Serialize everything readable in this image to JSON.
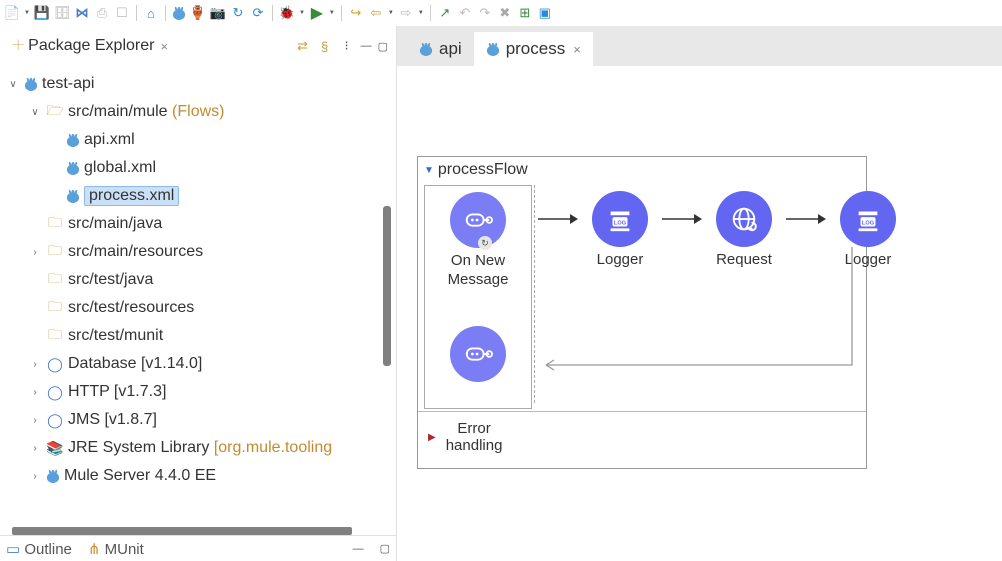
{
  "toolbar": {
    "icons": [
      "new",
      "save",
      "save-all",
      "vs",
      "disk",
      "box",
      "nav",
      "bunny",
      "jar",
      "camera",
      "build",
      "cycle",
      "bug",
      "run",
      "step-out",
      "step-back",
      "step-fwd",
      "stop",
      "open-ext",
      "undo",
      "redo",
      "close",
      "plus-box",
      "box2"
    ]
  },
  "packageExplorer": {
    "title": "Package Explorer",
    "tree": {
      "project": "test-api",
      "flowsFolder": {
        "label": "src/main/mule",
        "hint": "(Flows)"
      },
      "files": [
        "api.xml",
        "global.xml",
        "process.xml"
      ],
      "selectedFile": "process.xml",
      "folders": [
        "src/main/java",
        "src/main/resources",
        "src/test/java",
        "src/test/resources",
        "src/test/munit"
      ],
      "libs": [
        "Database [v1.14.0]",
        "HTTP [v1.7.3]",
        "JMS [v1.8.7]"
      ],
      "jre": {
        "label": "JRE System Library",
        "hint": "[org.mule.tooling"
      },
      "server": "Mule Server 4.4.0 EE"
    }
  },
  "bottomViews": {
    "outline": "Outline",
    "munit": "MUnit"
  },
  "editorTabs": {
    "api": "api",
    "process": "process",
    "active": "process"
  },
  "flow": {
    "name": "processFlow",
    "source": "On New\nMessage",
    "processors": [
      "Logger",
      "Request",
      "Logger"
    ],
    "errorSection": "Error\nhandling"
  }
}
